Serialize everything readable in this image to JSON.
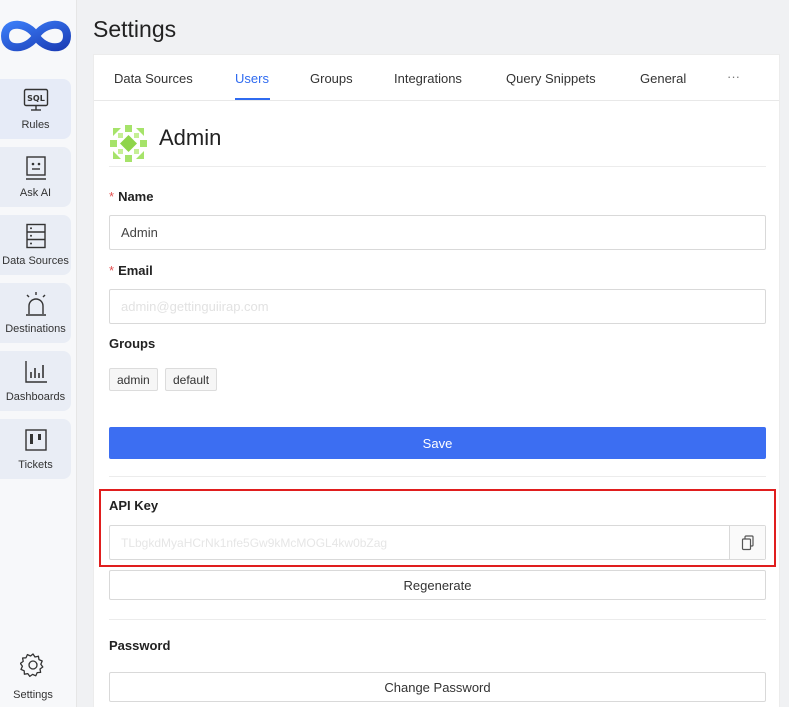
{
  "sidebar": {
    "items": [
      {
        "label": "Rules",
        "icon": "sql-icon"
      },
      {
        "label": "Ask AI",
        "icon": "robot-icon"
      },
      {
        "label": "Data Sources",
        "icon": "database-icon"
      },
      {
        "label": "Destinations",
        "icon": "alarm-icon"
      },
      {
        "label": "Dashboards",
        "icon": "bar-chart-icon"
      },
      {
        "label": "Tickets",
        "icon": "kanban-icon"
      }
    ],
    "settings_label": "Settings"
  },
  "header": {
    "title": "Settings"
  },
  "tabs": [
    {
      "label": "Data Sources"
    },
    {
      "label": "Users"
    },
    {
      "label": "Groups"
    },
    {
      "label": "Integrations"
    },
    {
      "label": "Query Snippets"
    },
    {
      "label": "General"
    },
    {
      "label": "···"
    }
  ],
  "user": {
    "name": "Admin"
  },
  "form": {
    "required_mark": "*",
    "name_label": "Name",
    "name_value": "Admin",
    "email_label": "Email",
    "email_value": "admin@gettinguiirap.com",
    "groups_label": "Groups",
    "groups": [
      "admin",
      "default"
    ],
    "save_label": "Save",
    "api_key_label": "API Key",
    "api_key_value": "TLbgkdMyaHCrNk1nfe5Gw9kMcMOGL4kw0bZag",
    "regenerate_label": "Regenerate",
    "password_label": "Password",
    "change_password_label": "Change Password"
  },
  "colors": {
    "accent": "#3c6ef2",
    "highlight": "#e01e1e"
  }
}
